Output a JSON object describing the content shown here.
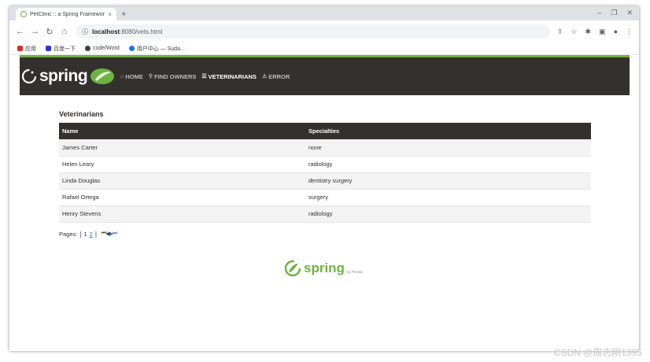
{
  "browser": {
    "tab_title": "PetClinic :: a Spring Framework",
    "tab_close": "×",
    "new_tab": "+",
    "url_host": "localhost",
    "url_path": ":8080/vets.html",
    "bookmarks": [
      {
        "label": "应用",
        "color": "#d93025"
      },
      {
        "label": "百度一下",
        "color": "#2932e1"
      },
      {
        "label": "code/Word",
        "color": "#3c4043"
      },
      {
        "label": "用户中心 — Suda...",
        "color": "#1a73e8"
      }
    ]
  },
  "nav": {
    "brand": "spring",
    "items": [
      {
        "label": "HOME",
        "icon": "home-icon",
        "glyph": "⌂"
      },
      {
        "label": "FIND OWNERS",
        "icon": "search-icon",
        "glyph": "⚲"
      },
      {
        "label": "VETERINARIANS",
        "icon": "list-icon",
        "glyph": "☰"
      },
      {
        "label": "ERROR",
        "icon": "warning-icon",
        "glyph": "⚠"
      }
    ],
    "active": "VETERINARIANS"
  },
  "main": {
    "heading": "Veterinarians",
    "columns": [
      "Name",
      "Specialties"
    ],
    "rows": [
      [
        "James Carter",
        "none"
      ],
      [
        "Helen Leary",
        "radiology"
      ],
      [
        "Linda Douglas",
        "dentistry surgery"
      ],
      [
        "Rafael Ortega",
        "surgery"
      ],
      [
        "Henry Stevens",
        "radiology"
      ]
    ]
  },
  "pagination": {
    "label": "Pages:",
    "open": "[",
    "pages": [
      "1",
      "2"
    ],
    "current": "1",
    "close": "]",
    "nav_glyphs": [
      "⏮",
      "◀",
      "▶",
      "⏭"
    ]
  },
  "footer": {
    "brand": "spring",
    "by": "by Pivotal."
  },
  "watermark": "CSDN @周志刚1395",
  "colors": {
    "spring_green": "#6db33f",
    "header_dark": "#34302d",
    "link_blue": "#2a6ebf"
  }
}
